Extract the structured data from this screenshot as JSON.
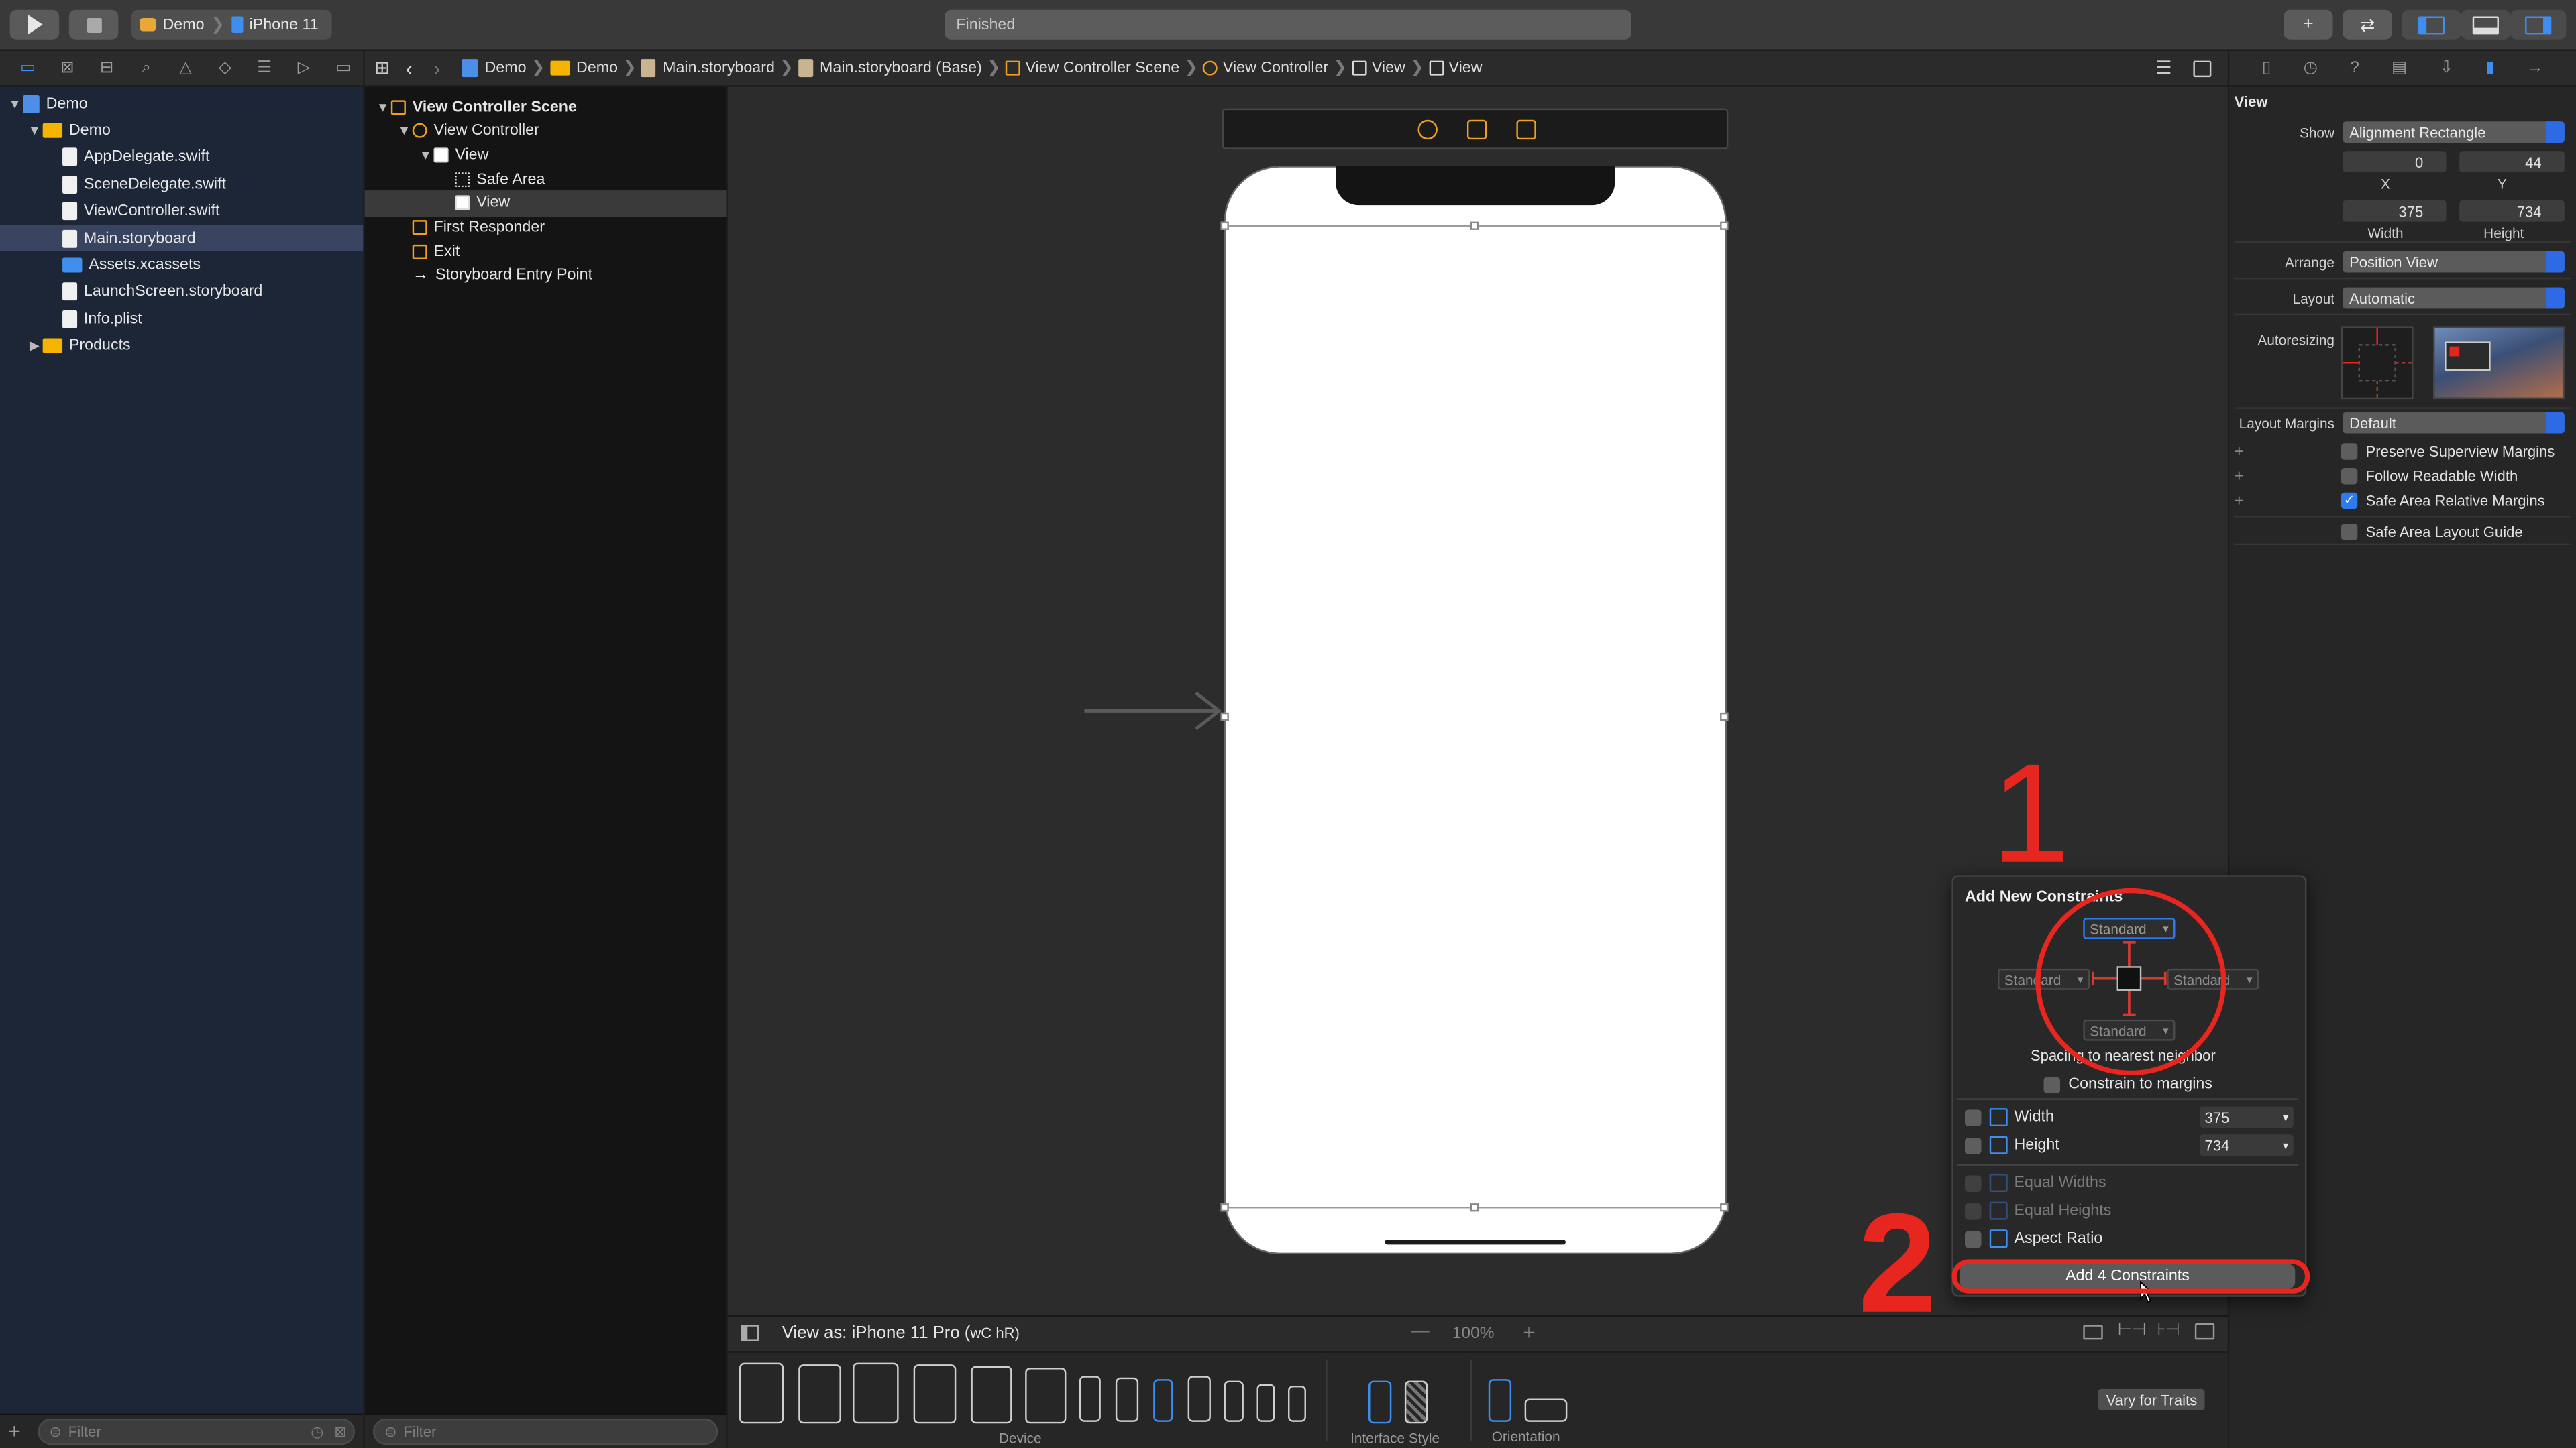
{
  "toolbar": {
    "scheme": "Demo",
    "device": "iPhone 11",
    "status": "Finished",
    "add_symbol": "+",
    "swap_symbol": "⇄"
  },
  "navigator_tabs": [
    "folder",
    "x",
    "hierarchy",
    "search",
    "warning",
    "diamond",
    "list",
    "tag",
    "comment"
  ],
  "jump_bar": [
    "Demo",
    "Demo",
    "Main.storyboard",
    "Main.storyboard (Base)",
    "View Controller Scene",
    "View Controller",
    "View",
    "View"
  ],
  "project": {
    "items": [
      {
        "label": "Demo",
        "kind": "project",
        "indent": 0,
        "expanded": true
      },
      {
        "label": "Demo",
        "kind": "folder",
        "indent": 1,
        "expanded": true
      },
      {
        "label": "AppDelegate.swift",
        "kind": "file",
        "indent": 2
      },
      {
        "label": "SceneDelegate.swift",
        "kind": "file",
        "indent": 2
      },
      {
        "label": "ViewController.swift",
        "kind": "file",
        "indent": 2
      },
      {
        "label": "Main.storyboard",
        "kind": "file",
        "indent": 2,
        "selected": true
      },
      {
        "label": "Assets.xcassets",
        "kind": "asset",
        "indent": 2
      },
      {
        "label": "LaunchScreen.storyboard",
        "kind": "file",
        "indent": 2
      },
      {
        "label": "Info.plist",
        "kind": "file",
        "indent": 2
      },
      {
        "label": "Products",
        "kind": "folder",
        "indent": 1,
        "expanded": false
      }
    ],
    "filter_placeholder": "Filter"
  },
  "outline": {
    "items": [
      {
        "label": "View Controller Scene",
        "indent": 0,
        "bold": true,
        "expanded": true
      },
      {
        "label": "View Controller",
        "indent": 1,
        "expanded": true
      },
      {
        "label": "View",
        "indent": 2,
        "expanded": true
      },
      {
        "label": "Safe Area",
        "indent": 3
      },
      {
        "label": "View",
        "indent": 3,
        "selected": true
      },
      {
        "label": "First Responder",
        "indent": 1
      },
      {
        "label": "Exit",
        "indent": 1
      },
      {
        "label": "Storyboard Entry Point",
        "indent": 1
      }
    ],
    "filter_placeholder": "Filter"
  },
  "canvas": {
    "view_as": "View as: iPhone 11 Pro (",
    "size_class": "wC hR)",
    "zoom": "100%",
    "zoom_minus": "—",
    "zoom_plus": "+",
    "vary_for_traits": "Vary for Traits",
    "device_label": "Device",
    "interface_style_label": "Interface Style",
    "orientation_label": "Orientation"
  },
  "inspector": {
    "title": "View",
    "show_label": "Show",
    "show_value": "Alignment Rectangle",
    "x_value": "0",
    "y_value": "44",
    "x_label": "X",
    "y_label": "Y",
    "width_value": "375",
    "height_value": "734",
    "width_label": "Width",
    "height_label": "Height",
    "arrange_label": "Arrange",
    "arrange_value": "Position View",
    "layout_label": "Layout",
    "layout_value": "Automatic",
    "autoresizing_label": "Autoresizing",
    "layout_margins_label": "Layout Margins",
    "layout_margins_value": "Default",
    "checks": [
      {
        "label": "Preserve Superview Margins",
        "checked": false
      },
      {
        "label": "Follow Readable Width",
        "checked": false
      },
      {
        "label": "Safe Area Relative Margins",
        "checked": true
      },
      {
        "label": "Safe Area Layout Guide",
        "checked": false
      }
    ]
  },
  "constraints_popover": {
    "title": "Add New Constraints",
    "top": "Standard",
    "left": "Standard",
    "right": "Standard",
    "bottom": "Standard",
    "spacing_caption": "Spacing to nearest neighbor",
    "constrain_margins": "Constrain to margins",
    "width_label": "Width",
    "width_value": "375",
    "height_label": "Height",
    "height_value": "734",
    "equal_widths": "Equal Widths",
    "equal_heights": "Equal Heights",
    "aspect_ratio": "Aspect Ratio",
    "add_button": "Add 4 Constraints"
  },
  "annotations": {
    "step1": "1",
    "step2": "2",
    "color": "#e6261f"
  }
}
